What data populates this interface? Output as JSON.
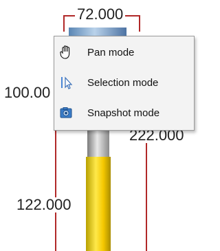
{
  "dimensions": {
    "top_width": "72.000",
    "left_length": "100.00",
    "right_length": "222.000",
    "bottom_length": "122.000"
  },
  "colors": {
    "bracket": "#b02828",
    "menu_background": "#f3f3f3",
    "pipe_yellow": "#ffe94a",
    "pipe_blue": "#6f97c4"
  },
  "context_menu": {
    "items": [
      {
        "label": "Pan mode",
        "icon": "hand-icon"
      },
      {
        "label": "Selection mode",
        "icon": "selection-cursor-icon"
      },
      {
        "label": "Snapshot mode",
        "icon": "camera-icon"
      }
    ]
  }
}
